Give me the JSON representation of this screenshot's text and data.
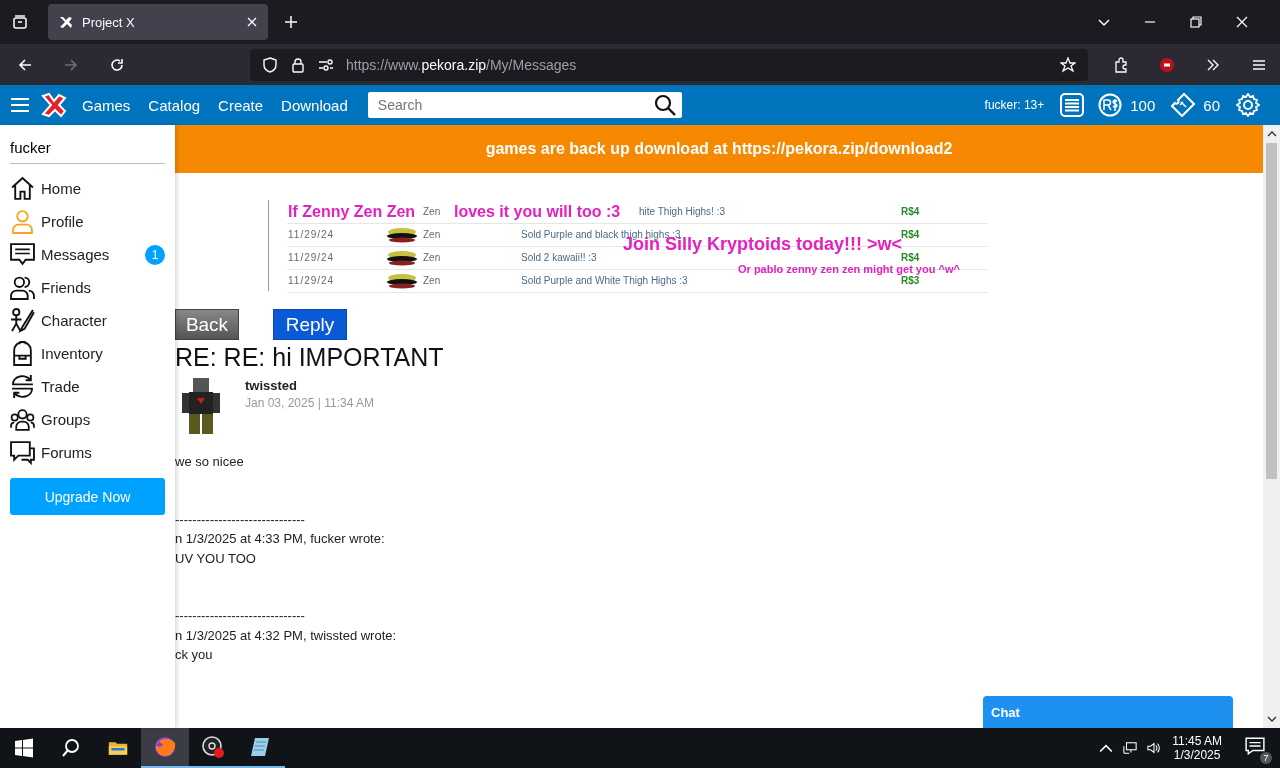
{
  "browser": {
    "tab_title": "Project X",
    "url_prefix": "https://www.",
    "url_domain": "pekora.zip",
    "url_path": "/My/Messages"
  },
  "site_nav": {
    "links": [
      "Games",
      "Catalog",
      "Create",
      "Download"
    ],
    "search_placeholder": "Search",
    "username": "fucker: 13+",
    "robux": "100",
    "tickets": "60"
  },
  "banner": "games are back up download at https://pekora.zip/download2",
  "sidebar": {
    "username": "fucker",
    "items": [
      {
        "label": "Home",
        "kind": "home"
      },
      {
        "label": "Profile",
        "kind": "profile"
      },
      {
        "label": "Messages",
        "kind": "messages",
        "badge": "1"
      },
      {
        "label": "Friends",
        "kind": "friends"
      },
      {
        "label": "Character",
        "kind": "character"
      },
      {
        "label": "Inventory",
        "kind": "inventory"
      },
      {
        "label": "Trade",
        "kind": "trade"
      },
      {
        "label": "Groups",
        "kind": "groups"
      },
      {
        "label": "Forums",
        "kind": "forums"
      }
    ],
    "upgrade": "Upgrade Now"
  },
  "ad": {
    "rows": [
      {
        "name": "Zen",
        "description": "hite Thigh Highs! :3",
        "price": "R$4"
      },
      {
        "date": "11/29/24",
        "name": "Zen",
        "description": "Sold Purple and black thigh highs :3",
        "price": "R$4"
      },
      {
        "date": "11/29/24",
        "name": "Zen",
        "description": "Sold 2 kawaii!! :3",
        "price": "R$4"
      },
      {
        "date": "11/29/24",
        "name": "Zen",
        "description": "Sold Purple and White Thigh Highs :3",
        "price": "R$3"
      }
    ],
    "overlay_texts": [
      "If Zenny Zen Zen",
      "loves it you will too :3",
      "Join Silly Kryptoids today!!! >w<",
      "Or pablo zenny zen zen might get you ^w^"
    ]
  },
  "message": {
    "back": "Back",
    "reply": "Reply",
    "subject": "RE: RE: hi IMPORTANT",
    "author": "twissted",
    "date": "Jan 03, 2025 | 11:34 AM",
    "paragraphs": [
      [
        "we so nicee"
      ],
      [
        "------------------------------",
        "n 1/3/2025 at 4:33 PM, fucker wrote:",
        "UV YOU TOO"
      ],
      [
        "------------------------------",
        "n 1/3/2025 at 4:32 PM, twissted wrote:",
        "ck you"
      ]
    ]
  },
  "chat": "Chat",
  "taskbar": {
    "time": "11:45 AM",
    "date": "1/3/2025",
    "notifications": "7"
  }
}
